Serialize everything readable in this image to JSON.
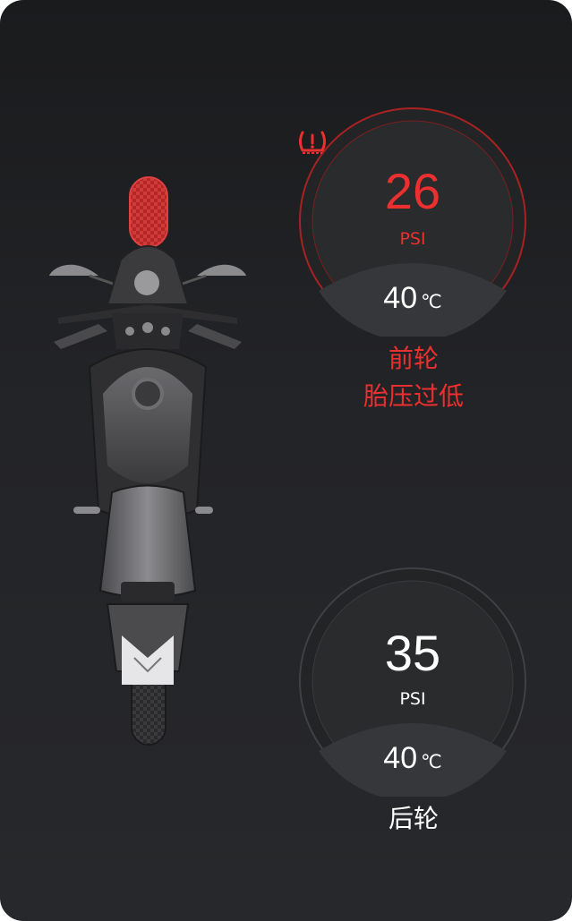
{
  "colors": {
    "alert": "#ec2f2f",
    "normal": "#ffffff",
    "background": "#1f2022"
  },
  "front": {
    "icon": "tire-pressure-warning-icon",
    "value": "26",
    "unit": "PSI",
    "temp_value": "40",
    "temp_unit": "℃",
    "label_line1": "前轮",
    "label_line2": "胎压过低",
    "status": "alert"
  },
  "rear": {
    "value": "35",
    "unit": "PSI",
    "temp_value": "40",
    "temp_unit": "℃",
    "label": "后轮",
    "status": "normal"
  }
}
